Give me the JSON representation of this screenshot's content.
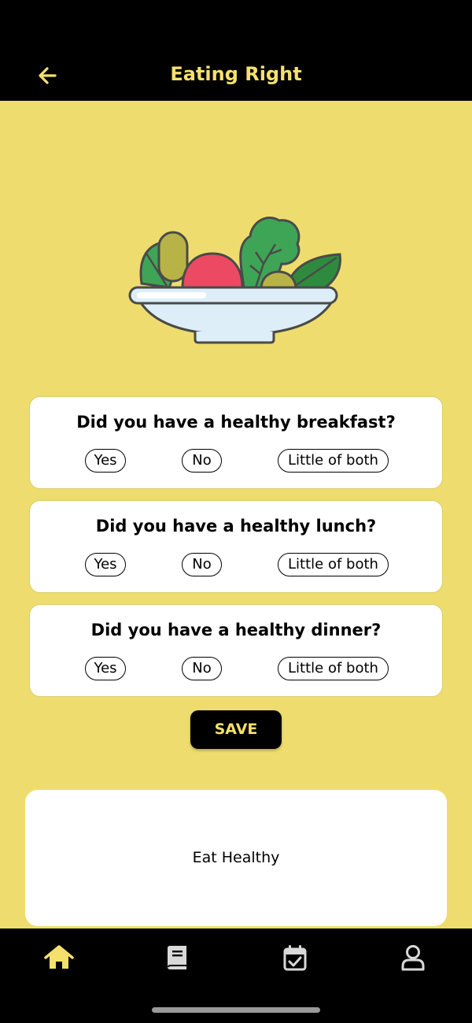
{
  "header": {
    "title": "Eating Right",
    "back_icon": "arrow-left-icon",
    "accent_color": "#F5E06E"
  },
  "hero": {
    "icon": "salad-bowl-illustration"
  },
  "questions": [
    {
      "text": "Did you have a healthy breakfast?",
      "options": [
        "Yes",
        "No",
        "Little of both"
      ]
    },
    {
      "text": "Did you have a healthy lunch?",
      "options": [
        "Yes",
        "No",
        "Little of both"
      ]
    },
    {
      "text": "Did you have a healthy dinner?",
      "options": [
        "Yes",
        "No",
        "Little of both"
      ]
    }
  ],
  "save_label": "SAVE",
  "tip": {
    "text": "Eat Healthy"
  },
  "tabs": [
    {
      "icon": "home-icon",
      "active": true
    },
    {
      "icon": "book-icon",
      "active": false
    },
    {
      "icon": "calendar-check-icon",
      "active": false
    },
    {
      "icon": "profile-icon",
      "active": false
    }
  ],
  "colors": {
    "background": "#EEDD6E",
    "bars": "#000000",
    "card": "#FFFFFF"
  }
}
